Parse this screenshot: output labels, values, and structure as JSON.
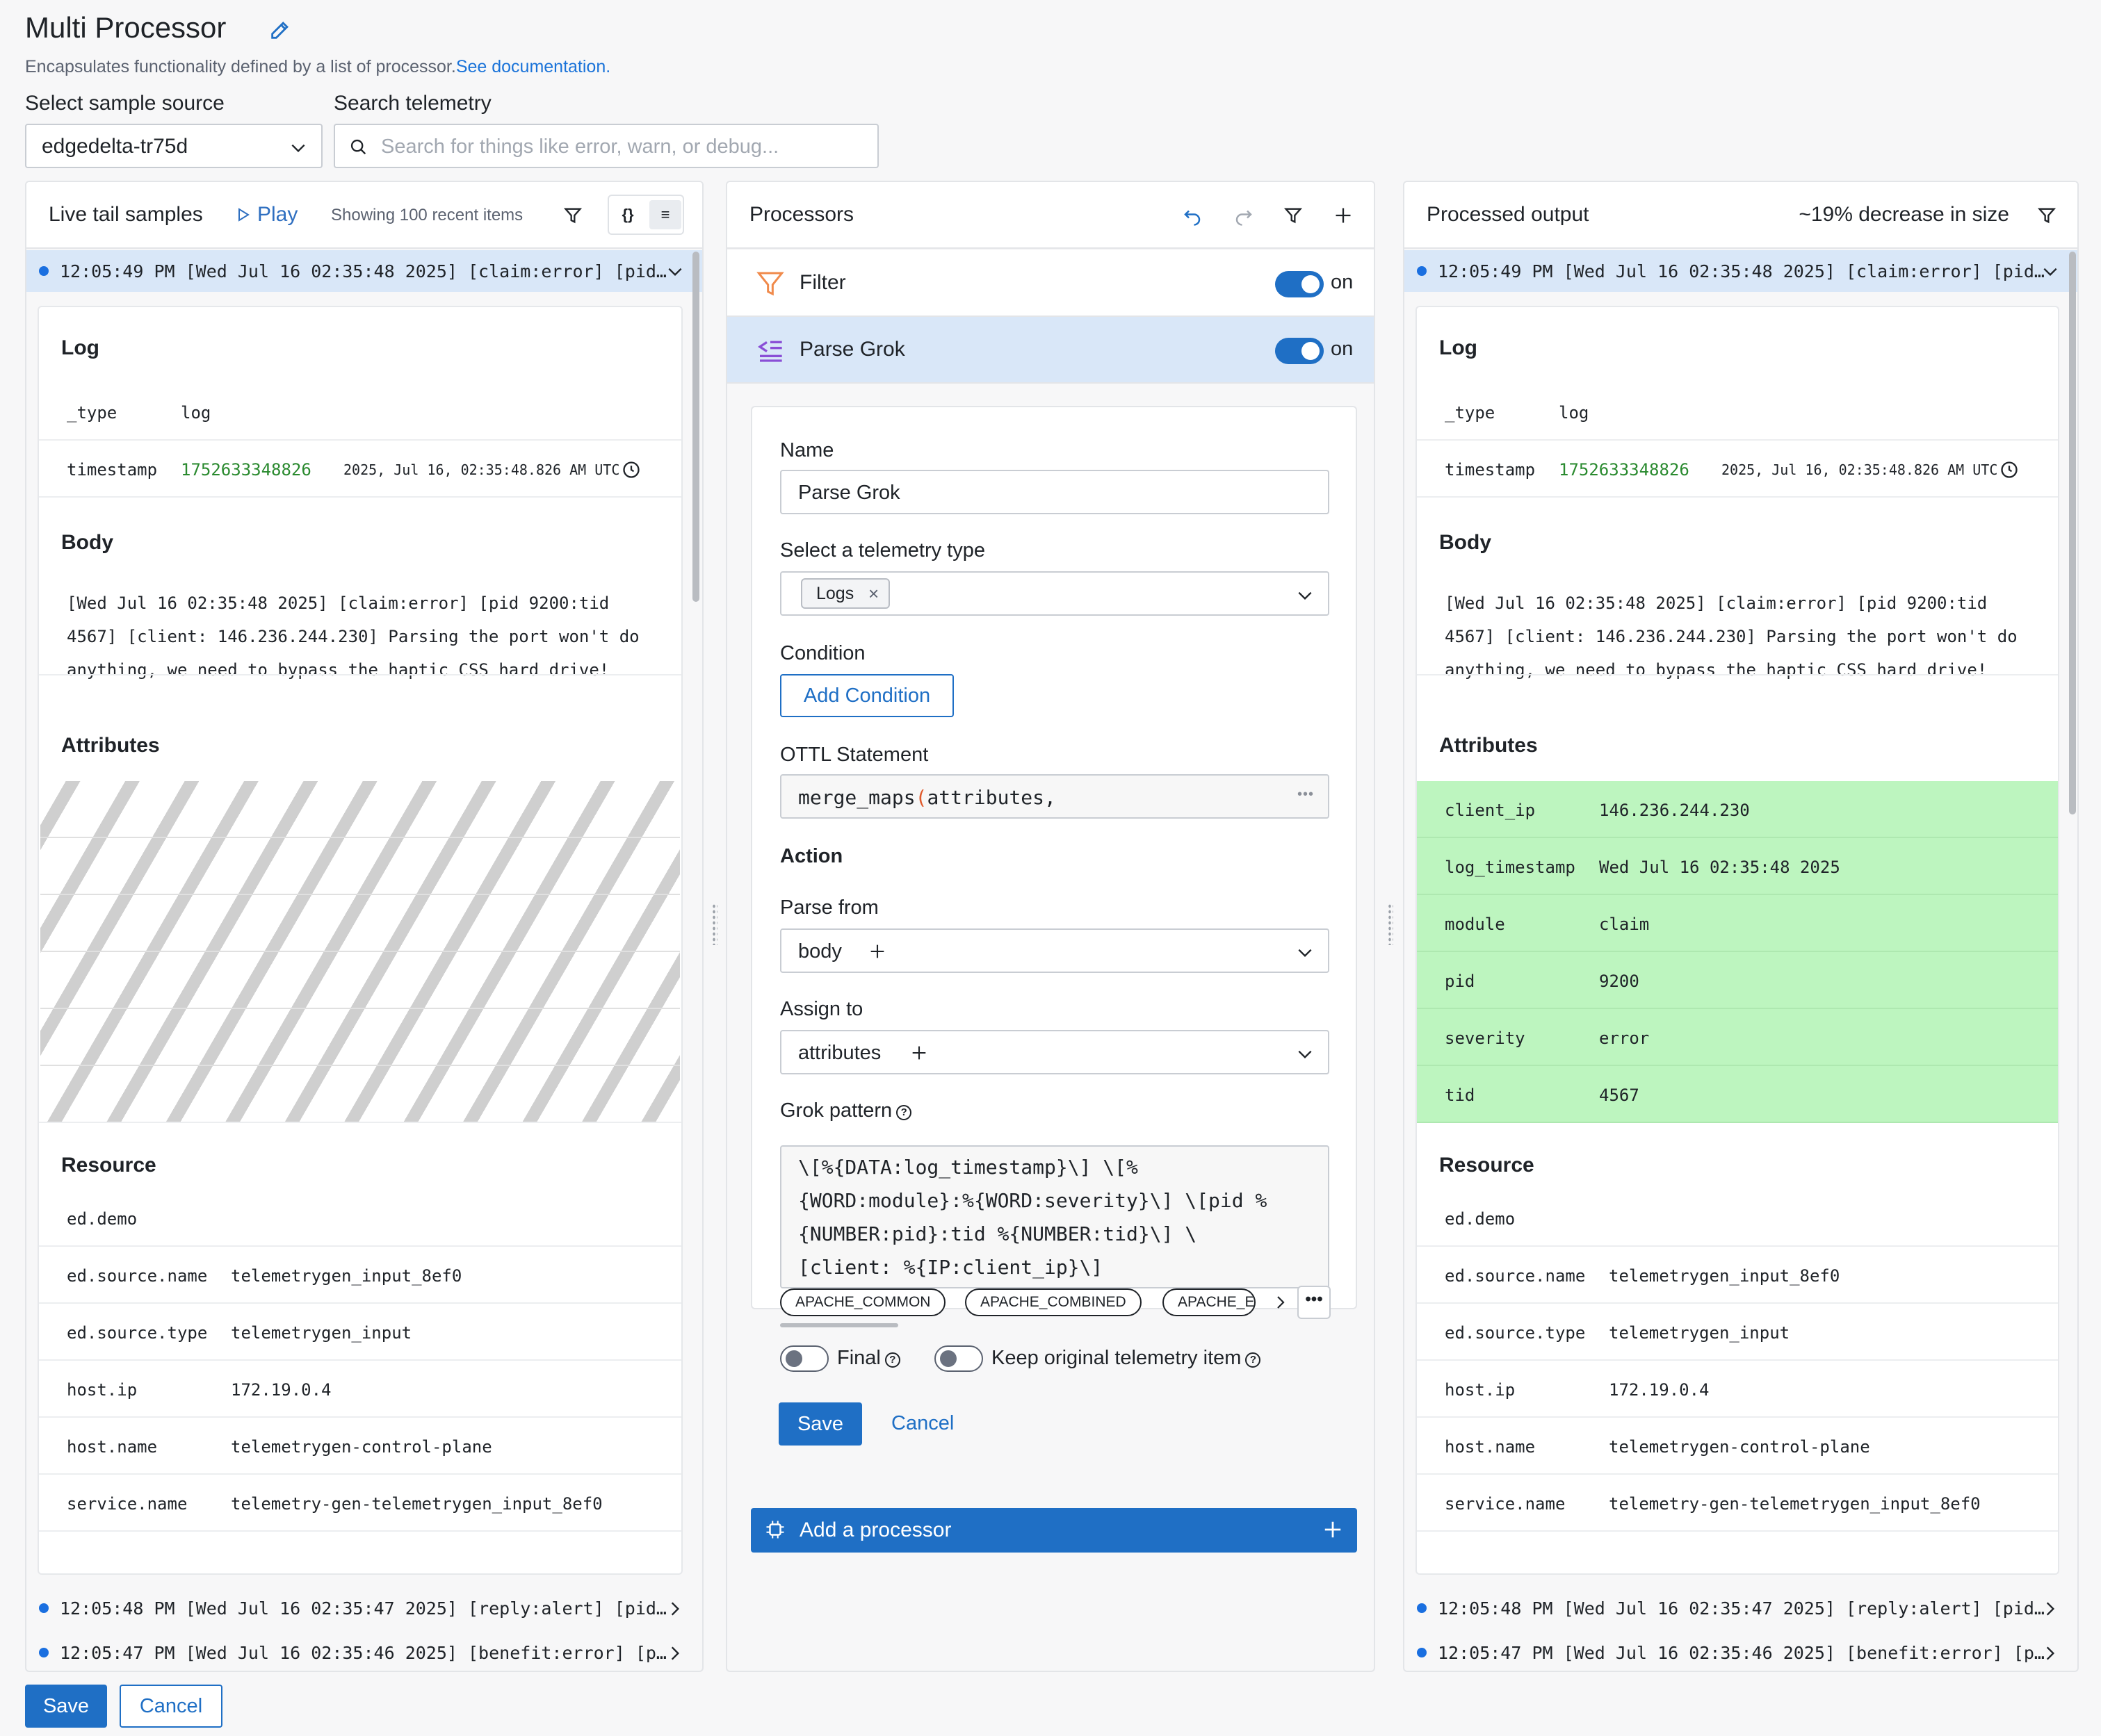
{
  "header": {
    "title": "Multi Processor",
    "description": "Encapsulates functionality defined by a list of processor.",
    "doc_link": "See documentation.",
    "sample_source_label": "Select sample source",
    "sample_source_value": "edgedelta-tr75d",
    "search_label": "Search telemetry",
    "search_placeholder": "Search for things like error, warn, or debug..."
  },
  "live_tail": {
    "title": "Live tail samples",
    "play_label": "Play",
    "showing": "Showing 100 recent items",
    "view_json": "{}",
    "view_list": "≡",
    "rows": [
      "12:05:49 PM [Wed Jul 16 02:35:48 2025] [claim:error] [pid…",
      "12:05:48 PM [Wed Jul 16 02:35:47 2025] [reply:alert] [pid…",
      "12:05:47 PM [Wed Jul 16 02:35:46 2025] [benefit:error] [p…"
    ],
    "detail": {
      "log_title": "Log",
      "type_key": "_type",
      "type_val": "log",
      "ts_key": "timestamp",
      "ts_val": "1752633348826",
      "ts_human": "2025, Jul 16, 02:35:48.826 AM UTC",
      "body_title": "Body",
      "body_text": "[Wed Jul 16 02:35:48 2025] [claim:error] [pid 9200:tid 4567] [client: 146.236.244.230] Parsing the port won't do anything, we need to bypass the haptic CSS hard drive!",
      "attributes_title": "Attributes",
      "resource_title": "Resource",
      "resource": [
        {
          "k": "ed.demo",
          "v": ""
        },
        {
          "k": "ed.source.name",
          "v": "telemetrygen_input_8ef0"
        },
        {
          "k": "ed.source.type",
          "v": "telemetrygen_input"
        },
        {
          "k": "host.ip",
          "v": "172.19.0.4"
        },
        {
          "k": "host.name",
          "v": "telemetrygen-control-plane"
        },
        {
          "k": "service.name",
          "v": "telemetry-gen-telemetrygen_input_8ef0"
        }
      ]
    }
  },
  "processors": {
    "title": "Processors",
    "items": [
      {
        "name": "Filter",
        "state": "on"
      },
      {
        "name": "Parse Grok",
        "state": "on"
      }
    ],
    "form": {
      "name_label": "Name",
      "name_value": "Parse Grok",
      "telemetry_label": "Select a telemetry type",
      "telemetry_chip": "Logs",
      "condition_label": "Condition",
      "add_condition": "Add Condition",
      "ottl_label": "OTTL Statement",
      "ottl_fn": "merge_maps",
      "ottl_paren": "(",
      "ottl_arg": "attributes,",
      "action_label": "Action",
      "parse_from_label": "Parse from",
      "parse_from_value": "body",
      "assign_to_label": "Assign to",
      "assign_to_value": "attributes",
      "grok_label": "Grok pattern",
      "grok_lines": [
        "\\[%{DATA:log_timestamp}\\] \\[%",
        "{WORD:module}:%{WORD:severity}\\] \\[pid %",
        "{NUMBER:pid}:tid %{NUMBER:tid}\\] \\",
        "[client: %{IP:client_ip}\\]"
      ],
      "patterns": [
        "APACHE_COMMON",
        "APACHE_COMBINED",
        "APACHE_ERROR"
      ],
      "final_label": "Final",
      "keep_label": "Keep original telemetry item",
      "save": "Save",
      "cancel": "Cancel"
    },
    "add_processor": "Add a processor"
  },
  "output": {
    "title": "Processed output",
    "size_change": "~19% decrease in size",
    "attributes": [
      {
        "k": "client_ip",
        "v": "146.236.244.230"
      },
      {
        "k": "log_timestamp",
        "v": "Wed Jul 16 02:35:48 2025"
      },
      {
        "k": "module",
        "v": "claim"
      },
      {
        "k": "pid",
        "v": "9200"
      },
      {
        "k": "severity",
        "v": "error"
      },
      {
        "k": "tid",
        "v": "4567"
      }
    ]
  },
  "footer": {
    "save": "Save",
    "cancel": "Cancel"
  },
  "colors": {
    "accent": "#1f6fc5",
    "selected_row": "#d9e7f8",
    "highlight_attr": "#bdf5bf",
    "timestamp_green": "#2a8a2f"
  }
}
